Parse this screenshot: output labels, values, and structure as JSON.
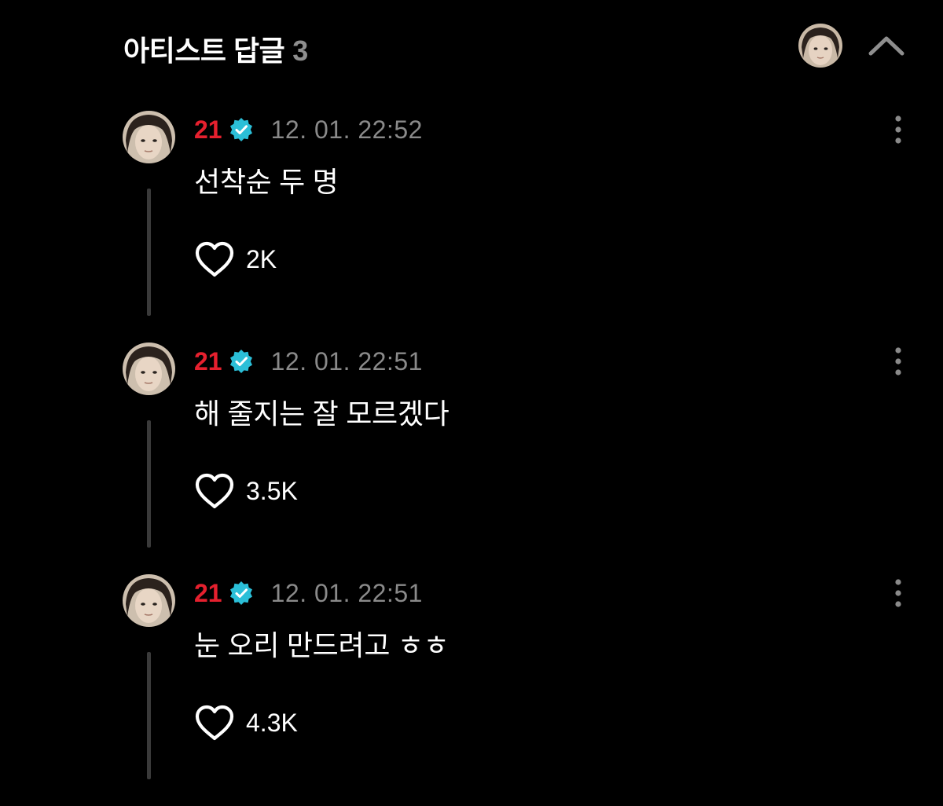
{
  "header": {
    "title": "아티스트 답글",
    "count": "3",
    "avatar_icon": "artist-avatar",
    "collapse_icon": "chevron-up-icon"
  },
  "colors": {
    "background": "#000000",
    "username": "#e5202e",
    "verified_badge": "#2bbfd8",
    "timestamp": "#8a8a8a",
    "thread_line": "#3a3a3a"
  },
  "replies": [
    {
      "username": "21",
      "verified": true,
      "timestamp": "12. 01. 22:52",
      "text": "선착순 두 명",
      "likes": "2K"
    },
    {
      "username": "21",
      "verified": true,
      "timestamp": "12. 01. 22:51",
      "text": "해 줄지는 잘 모르겠다",
      "likes": "3.5K"
    },
    {
      "username": "21",
      "verified": true,
      "timestamp": "12. 01. 22:51",
      "text": "눈 오리 만드려고 ㅎㅎ",
      "likes": "4.3K"
    }
  ]
}
